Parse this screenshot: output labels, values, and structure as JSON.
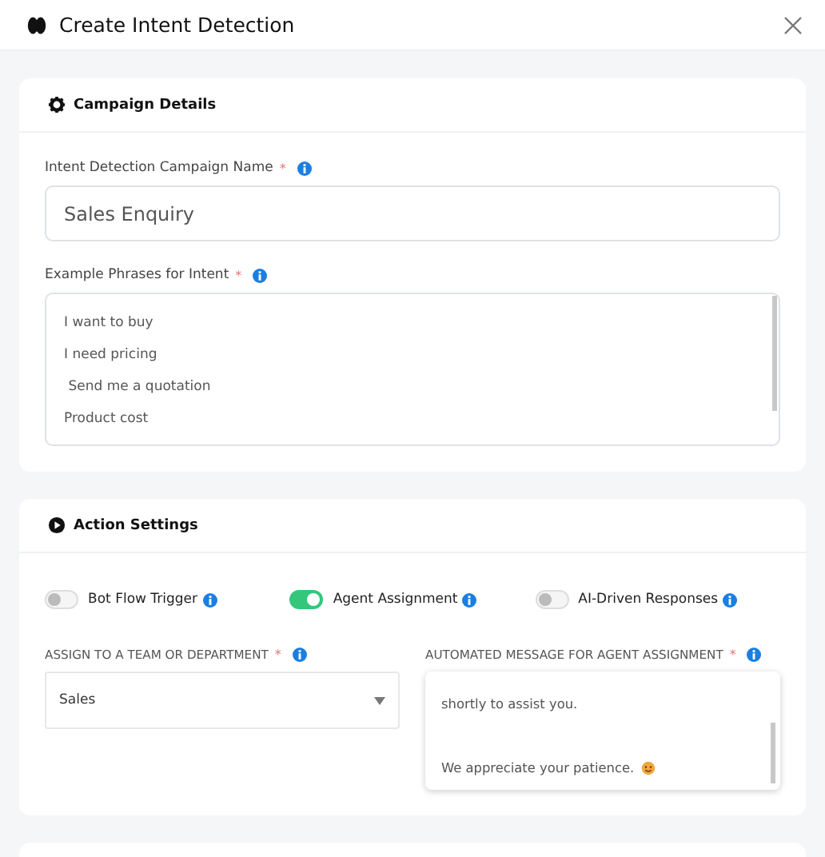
{
  "dialog": {
    "title": "Create Intent Detection"
  },
  "campaign_details": {
    "title": "Campaign Details",
    "name_field": {
      "label": "Intent Detection Campaign Name",
      "required_mark": "*",
      "value": "Sales Enquiry"
    },
    "phrases_field": {
      "label": "Example Phrases for Intent",
      "required_mark": "*",
      "lines": [
        "I want to buy",
        "I need pricing",
        " Send me a quotation",
        "Product cost"
      ]
    }
  },
  "action_settings": {
    "title": "Action Settings",
    "toggles": [
      {
        "label": "Bot Flow Trigger",
        "on": false
      },
      {
        "label": "Agent Assignment",
        "on": true
      },
      {
        "label": "AI-Driven Responses",
        "on": false
      }
    ],
    "team_select": {
      "label": "ASSIGN TO A TEAM OR DEPARTMENT",
      "required_mark": "*",
      "value": "Sales"
    },
    "message_field": {
      "label": "AUTOMATED MESSAGE FOR AGENT ASSIGNMENT",
      "required_mark": "*",
      "paragraphs": [
        "shortly to assist you.",
        "We appreciate your patience."
      ]
    }
  }
}
